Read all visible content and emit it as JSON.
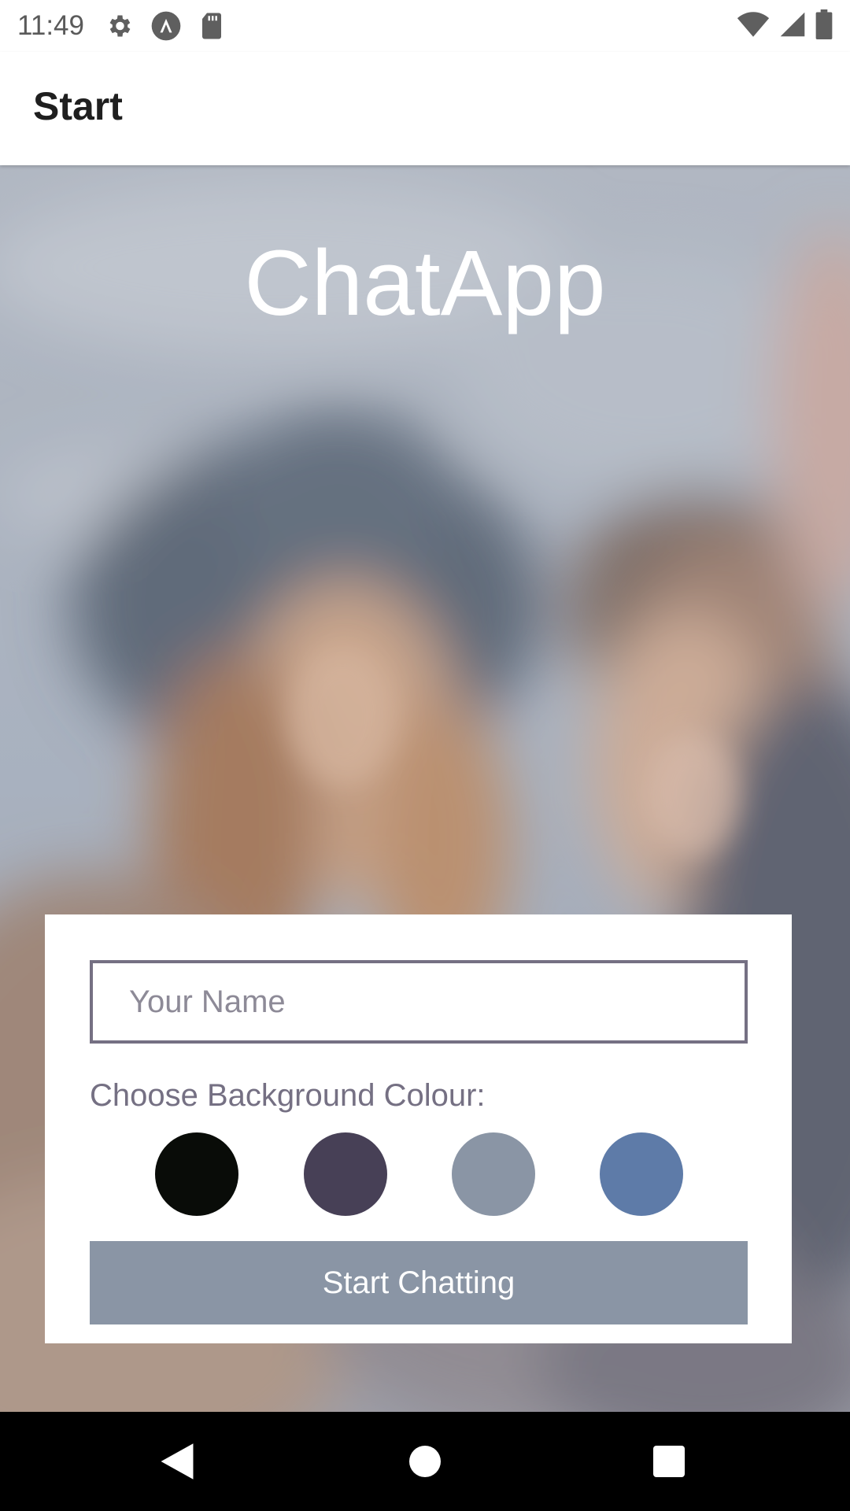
{
  "status_bar": {
    "time": "11:49",
    "left_icons": [
      "settings-icon",
      "app-notification-icon",
      "sd-card-icon"
    ],
    "right_icons": [
      "wifi-icon",
      "signal-icon",
      "battery-icon"
    ]
  },
  "app_bar": {
    "title": "Start"
  },
  "main": {
    "app_title": "ChatApp",
    "name_input": {
      "value": "",
      "placeholder": "Your Name"
    },
    "colour_label": "Choose Background Colour:",
    "colour_options": [
      "#090C08",
      "#474056",
      "#8A95A5",
      "#5E7BA8"
    ],
    "start_button_label": "Start Chatting",
    "start_button_color": "#8A95A5"
  },
  "colors": {
    "accent_text": "#757083",
    "card_background": "#FFFFFF"
  },
  "nav_bar": {
    "buttons": [
      "back-icon",
      "home-icon",
      "recents-icon"
    ]
  }
}
